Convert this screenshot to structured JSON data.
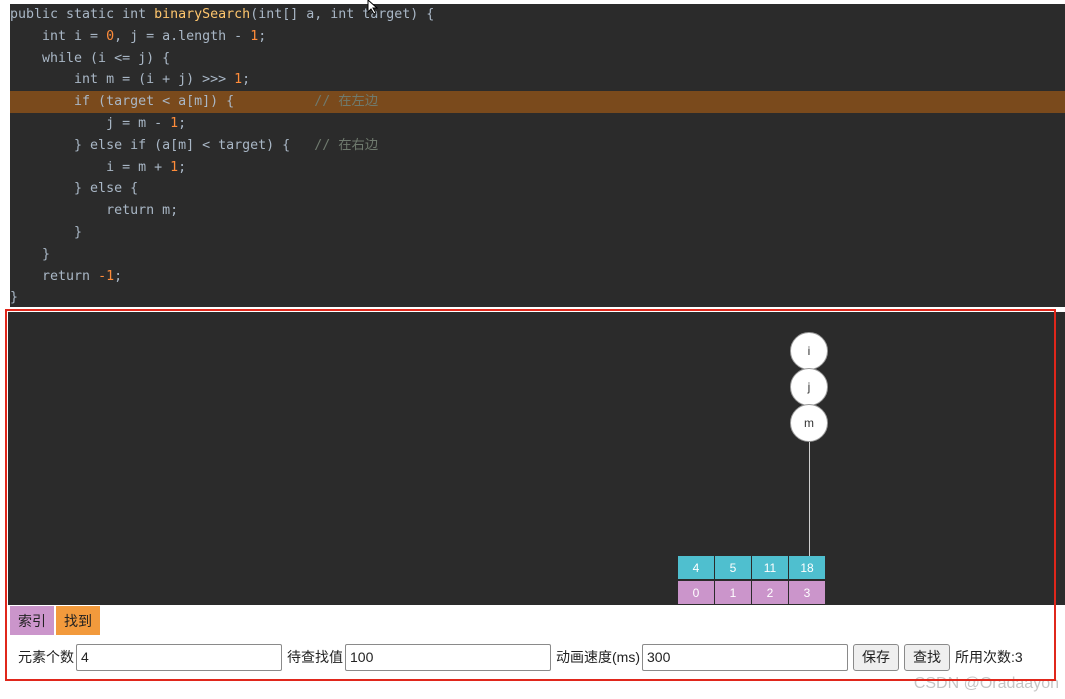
{
  "code": {
    "highlighted_line": 4,
    "lines": [
      [
        {
          "t": "public static int ",
          "c": "kw"
        },
        {
          "t": "binarySearch",
          "c": "fn"
        },
        {
          "t": "(int[] a, int target) {",
          "c": "kw"
        }
      ],
      [
        {
          "t": "    int i = ",
          "c": "kw"
        },
        {
          "t": "0",
          "c": "num"
        },
        {
          "t": ", j = a.length - ",
          "c": "kw"
        },
        {
          "t": "1",
          "c": "num"
        },
        {
          "t": ";",
          "c": "kw"
        }
      ],
      [
        {
          "t": "    while (i <= j) {",
          "c": "kw"
        }
      ],
      [
        {
          "t": "        int m = (i + j) >>> ",
          "c": "kw"
        },
        {
          "t": "1",
          "c": "num"
        },
        {
          "t": ";",
          "c": "kw"
        }
      ],
      [
        {
          "t": "        if (target < a[m]) {          ",
          "c": "kw"
        },
        {
          "t": "// 在左边",
          "c": "cm"
        }
      ],
      [
        {
          "t": "            j = m - ",
          "c": "kw"
        },
        {
          "t": "1",
          "c": "num"
        },
        {
          "t": ";",
          "c": "kw"
        }
      ],
      [
        {
          "t": "        } else if (a[m] < target) {   ",
          "c": "kw"
        },
        {
          "t": "// 在右边",
          "c": "cm"
        }
      ],
      [
        {
          "t": "            i = m + ",
          "c": "kw"
        },
        {
          "t": "1",
          "c": "num"
        },
        {
          "t": ";",
          "c": "kw"
        }
      ],
      [
        {
          "t": "        } else {",
          "c": "kw"
        }
      ],
      [
        {
          "t": "            return m;",
          "c": "kw"
        }
      ],
      [
        {
          "t": "        }",
          "c": "kw"
        }
      ],
      [
        {
          "t": "    }",
          "c": "kw"
        }
      ],
      [
        {
          "t": "    return ",
          "c": "kw"
        },
        {
          "t": "-1",
          "c": "num"
        },
        {
          "t": ";",
          "c": "kw"
        }
      ],
      [
        {
          "t": "}",
          "c": "kw"
        }
      ]
    ]
  },
  "visualization": {
    "pointers": [
      "i",
      "j",
      "m"
    ],
    "array": [
      {
        "value": "4",
        "index": "0"
      },
      {
        "value": "5",
        "index": "1"
      },
      {
        "value": "11",
        "index": "2"
      },
      {
        "value": "18",
        "index": "3"
      }
    ],
    "colors": {
      "value_cell": "#4fbfcf",
      "index_cell": "#cb95cb",
      "found": "#f29a3c"
    }
  },
  "legend": {
    "index_label": "索引",
    "found_label": "找到"
  },
  "controls": {
    "count_label": "元素个数",
    "count_value": "4",
    "target_label": "待查找值",
    "target_value": "100",
    "speed_label": "动画速度(ms)",
    "speed_value": "300",
    "save_label": "保存",
    "search_label": "查找",
    "result_text": "所用次数:3"
  },
  "watermark": "CSDN @Oradaayon"
}
